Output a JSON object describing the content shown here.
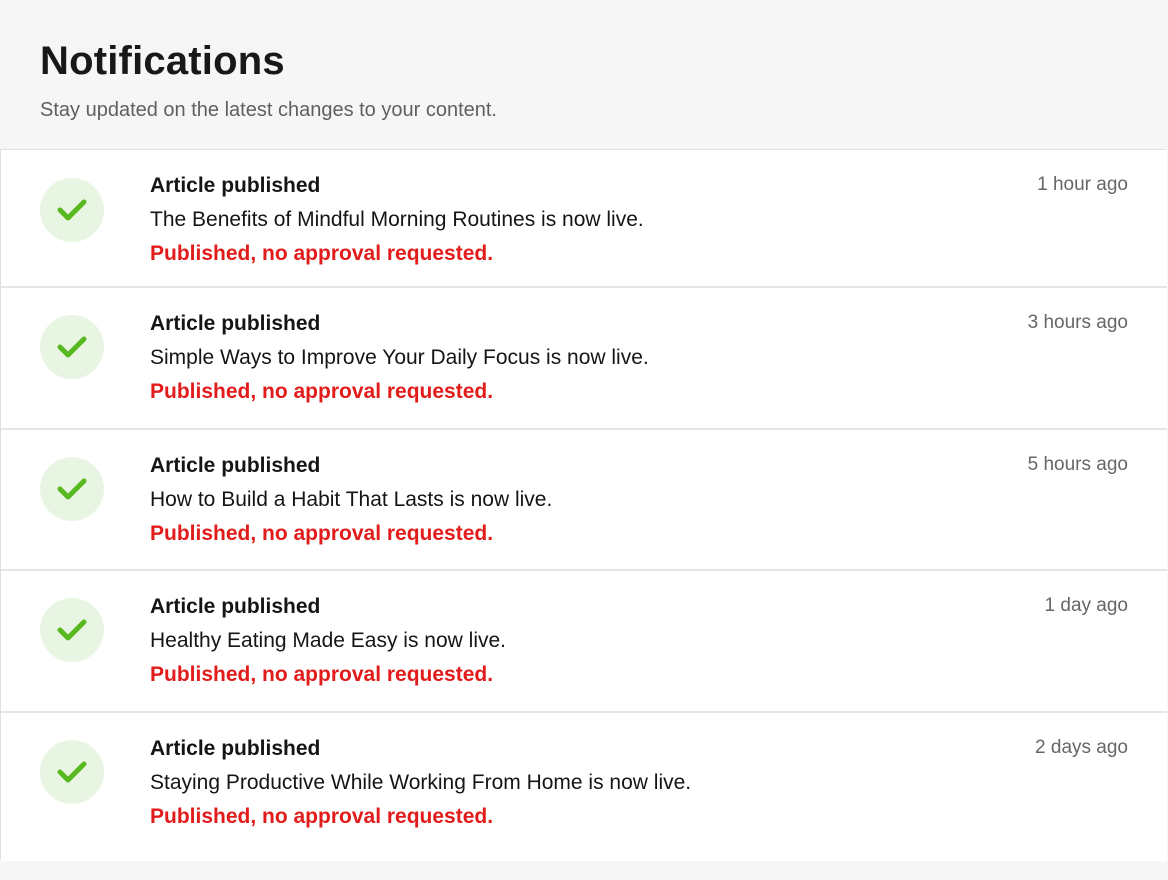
{
  "header": {
    "title": "Notifications",
    "subtitle": "Stay updated on the latest changes to your content."
  },
  "notifications": [
    {
      "title": "Article published",
      "message": "The Benefits of Mindful Morning Routines is now live.",
      "status": "Published, no approval requested.",
      "time": "1 hour ago",
      "icon": "check-icon"
    },
    {
      "title": "Article published",
      "message": "Simple Ways to Improve Your Daily Focus is now live.",
      "status": "Published, no approval requested.",
      "time": "3 hours ago",
      "icon": "check-icon"
    },
    {
      "title": "Article published",
      "message": "How to Build a Habit That Lasts is now live.",
      "status": "Published, no approval requested.",
      "time": "5 hours ago",
      "icon": "check-icon"
    },
    {
      "title": "Article published",
      "message": "Healthy Eating Made Easy is now live.",
      "status": "Published, no approval requested.",
      "time": "1 day ago",
      "icon": "check-icon"
    },
    {
      "title": "Article published",
      "message": "Staying Productive While Working From Home is now live.",
      "status": "Published, no approval requested.",
      "time": "2 days ago",
      "icon": "check-icon"
    }
  ],
  "colors": {
    "status": "#e21b1b",
    "success_icon": "#58b81f",
    "success_icon_bg": "#e9f5e3"
  }
}
